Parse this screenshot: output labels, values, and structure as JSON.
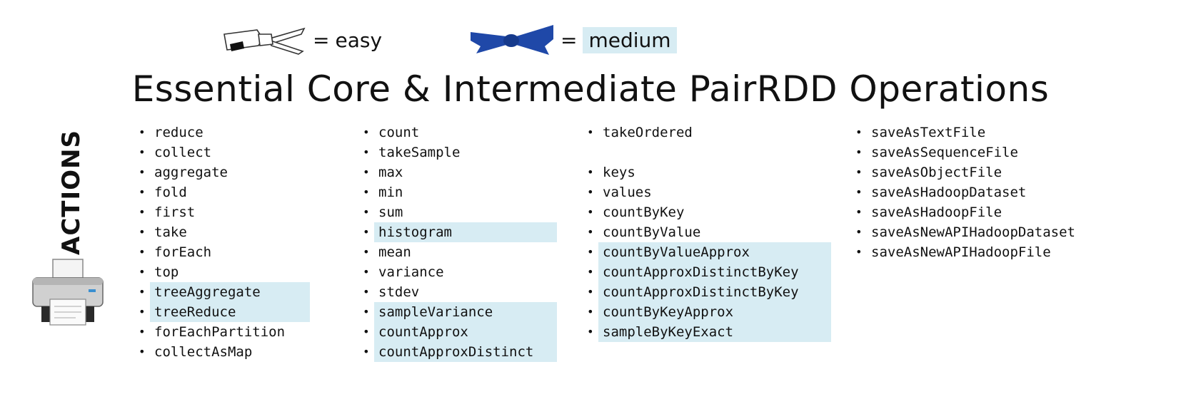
{
  "legend": {
    "easy": {
      "equals": "=",
      "label": "easy"
    },
    "medium": {
      "equals": "=",
      "label": "medium"
    }
  },
  "colors": {
    "easy_belt": "#ffffff",
    "medium_belt": "#1f48a8",
    "highlight": "#d7ecf3"
  },
  "title": "Essential Core & Intermediate PairRDD Operations",
  "side_label": "ACTIONS",
  "side_icon": "printer-icon",
  "columns": [
    {
      "items": [
        {
          "label": "reduce",
          "level": "easy"
        },
        {
          "label": "collect",
          "level": "easy"
        },
        {
          "label": "aggregate",
          "level": "easy"
        },
        {
          "label": "fold",
          "level": "easy"
        },
        {
          "label": "first",
          "level": "easy"
        },
        {
          "label": "take",
          "level": "easy"
        },
        {
          "label": "forEach",
          "level": "easy"
        },
        {
          "label": "top",
          "level": "easy"
        },
        {
          "label": "treeAggregate",
          "level": "medium"
        },
        {
          "label": "treeReduce",
          "level": "medium"
        },
        {
          "label": "forEachPartition",
          "level": "easy"
        },
        {
          "label": "collectAsMap",
          "level": "easy"
        }
      ]
    },
    {
      "items": [
        {
          "label": "count",
          "level": "easy"
        },
        {
          "label": "takeSample",
          "level": "easy"
        },
        {
          "label": "max",
          "level": "easy"
        },
        {
          "label": "min",
          "level": "easy"
        },
        {
          "label": "sum",
          "level": "easy"
        },
        {
          "label": "histogram",
          "level": "medium"
        },
        {
          "label": "mean",
          "level": "easy"
        },
        {
          "label": "variance",
          "level": "easy"
        },
        {
          "label": "stdev",
          "level": "easy"
        },
        {
          "label": "sampleVariance",
          "level": "medium"
        },
        {
          "label": "countApprox",
          "level": "medium"
        },
        {
          "label": "countApproxDistinct",
          "level": "medium"
        }
      ]
    },
    {
      "items": [
        {
          "label": "takeOrdered",
          "level": "easy"
        },
        {
          "label": "",
          "level": "gap"
        },
        {
          "label": "keys",
          "level": "easy"
        },
        {
          "label": "values",
          "level": "easy"
        },
        {
          "label": "countByKey",
          "level": "easy"
        },
        {
          "label": "countByValue",
          "level": "easy"
        },
        {
          "label": "countByValueApprox",
          "level": "medium"
        },
        {
          "label": "countApproxDistinctByKey",
          "level": "medium"
        },
        {
          "label": "countApproxDistinctByKey",
          "level": "medium"
        },
        {
          "label": "countByKeyApprox",
          "level": "medium"
        },
        {
          "label": "sampleByKeyExact",
          "level": "medium"
        }
      ]
    },
    {
      "items": [
        {
          "label": "saveAsTextFile",
          "level": "easy"
        },
        {
          "label": "saveAsSequenceFile",
          "level": "easy"
        },
        {
          "label": "saveAsObjectFile",
          "level": "easy"
        },
        {
          "label": "saveAsHadoopDataset",
          "level": "easy"
        },
        {
          "label": "saveAsHadoopFile",
          "level": "easy"
        },
        {
          "label": "saveAsNewAPIHadoopDataset",
          "level": "easy"
        },
        {
          "label": "saveAsNewAPIHadoopFile",
          "level": "easy"
        }
      ]
    }
  ]
}
